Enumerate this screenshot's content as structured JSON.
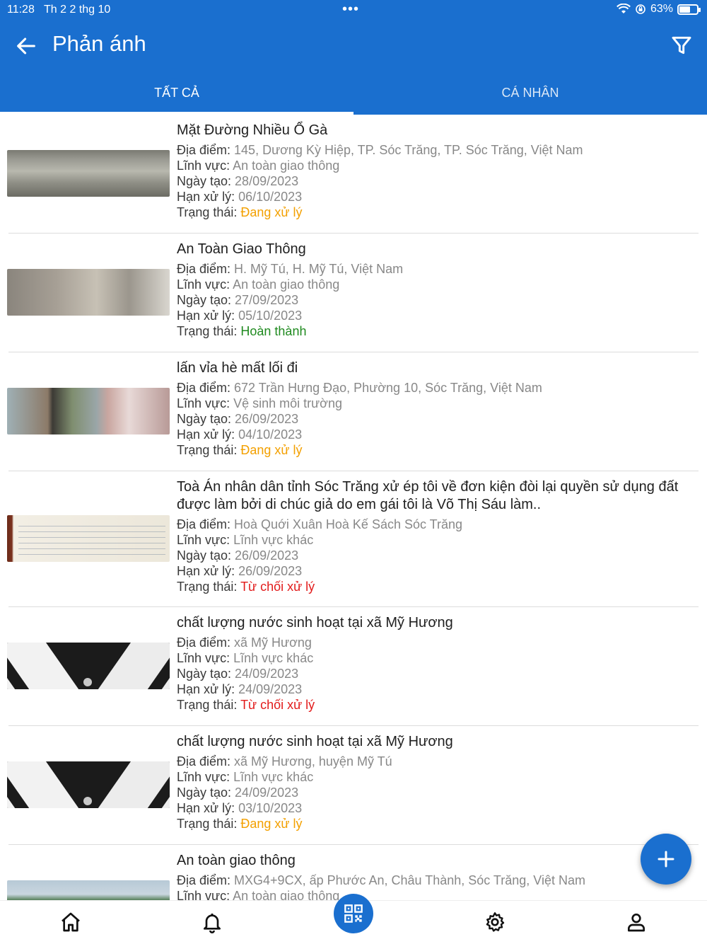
{
  "status_bar": {
    "time": "11:28",
    "date": "Th 2 2 thg 10",
    "dots": "•••",
    "battery": "63%",
    "battery_level": 0.63
  },
  "header": {
    "title": "Phản ánh",
    "tabs": [
      {
        "label": "TẤT CẢ",
        "active": true
      },
      {
        "label": "CÁ NHÂN",
        "active": false
      }
    ]
  },
  "labels": {
    "location": "Địa điểm: ",
    "field": "Lĩnh vực: ",
    "created": "Ngày tạo: ",
    "deadline": "Hạn xử lý: ",
    "status": "Trạng thái: "
  },
  "items": [
    {
      "title": "Mặt Đường Nhiều Ổ Gà",
      "location": "145, Dương Kỳ Hiệp, TP. Sóc Trăng, TP. Sóc Trăng, Việt Nam",
      "field": "An toàn giao thông",
      "created": "28/09/2023",
      "deadline": "06/10/2023",
      "status": "Đang xử lý"
    },
    {
      "title": "An Toàn Giao Thông",
      "location": "H. Mỹ Tú, H. Mỹ Tú, Việt Nam",
      "field": "An toàn giao thông",
      "created": "27/09/2023",
      "deadline": "05/10/2023",
      "status": "Hoàn thành"
    },
    {
      "title": "lấn vỉa hè mất lối đi",
      "location": "672 Trần Hưng Đạo, Phường 10, Sóc Trăng, Việt Nam",
      "field": "Vệ sinh môi trường",
      "created": "26/09/2023",
      "deadline": "04/10/2023",
      "status": "Đang xử lý"
    },
    {
      "title": "Toà Án nhân dân tỉnh Sóc Trăng xử ép tôi về đơn kiện  đòi lại  quyền sử dụng đất được làm bởi di chúc giả do em gái tôi là Võ Thị Sáu làm..",
      "location": "Hoà Quới Xuân Hoà Kế Sách Sóc Trăng",
      "field": "Lĩnh vực khác",
      "created": "26/09/2023",
      "deadline": "26/09/2023",
      "status": "Từ chối xử lý"
    },
    {
      "title": "chất lượng nước sinh hoạt tại xã Mỹ Hương",
      "location": "xã Mỹ Hương",
      "field": "Lĩnh vực khác",
      "created": "24/09/2023",
      "deadline": "24/09/2023",
      "status": "Từ chối xử lý"
    },
    {
      "title": "chất lượng nước sinh hoạt tại xã Mỹ Hương",
      "location": "xã Mỹ Hương, huyện Mỹ Tú",
      "field": "Lĩnh vực khác",
      "created": "24/09/2023",
      "deadline": "03/10/2023",
      "status": "Đang xử lý"
    },
    {
      "title": "An toàn giao thông",
      "location": "MXG4+9CX, ấp Phước An, Châu Thành, Sóc Trăng, Việt Nam",
      "field": "An toàn giao thông"
    }
  ],
  "fab_icon": "plus-icon",
  "status_colors": {
    "Đang xử lý": "#f3a000",
    "Hoàn thành": "#1f8a1f",
    "Từ chối xử lý": "#e21b1b"
  },
  "bottom_nav": [
    "home-icon",
    "bell-icon",
    "qr-code-icon",
    "gear-icon",
    "user-icon"
  ]
}
